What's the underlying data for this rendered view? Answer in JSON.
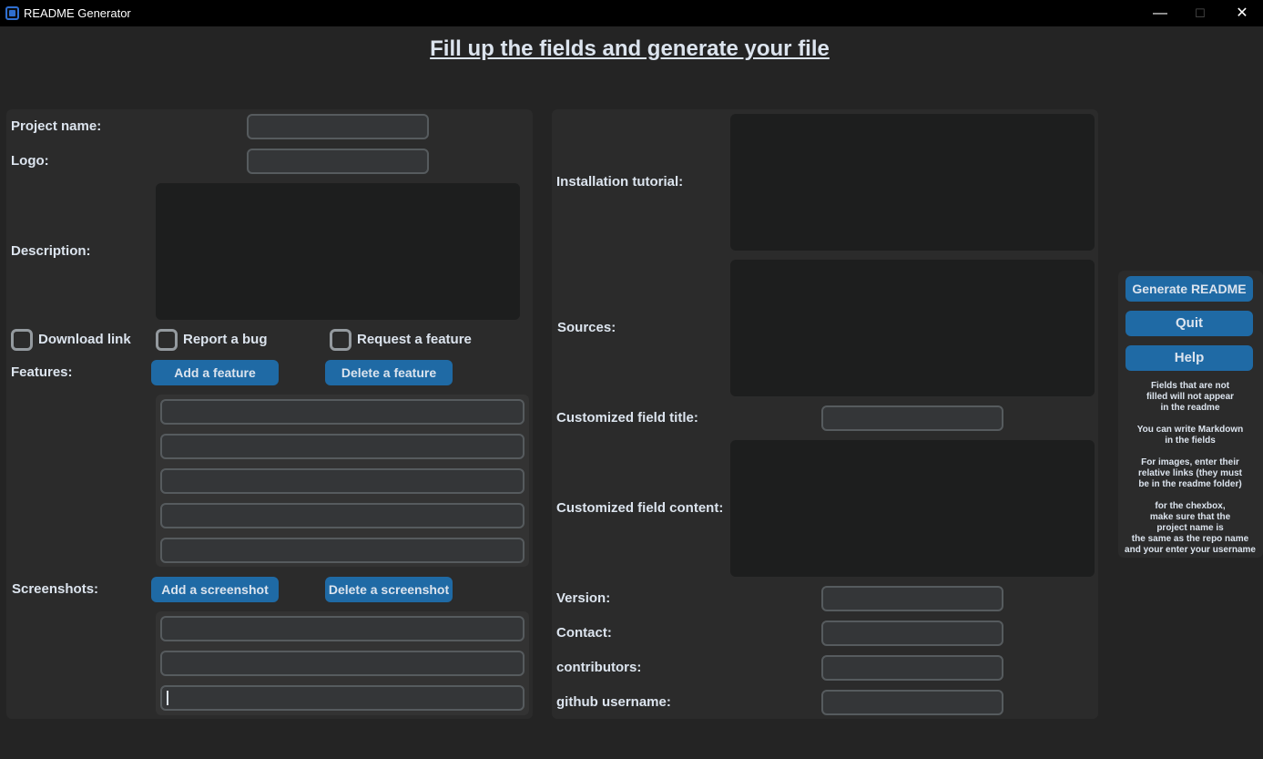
{
  "window": {
    "title": "README Generator",
    "minimize_label": "—",
    "maximize_label": "☐",
    "close_label": "✕"
  },
  "heading": "Fill up the fields and generate your file",
  "left": {
    "project_name_label": "Project name:",
    "logo_label": "Logo:",
    "description_label": "Description:",
    "download_link_label": "Download link",
    "report_bug_label": "Report a bug",
    "request_feature_label": "Request a feature",
    "features_label": "Features:",
    "add_feature_button": "Add a feature",
    "delete_feature_button": "Delete a feature",
    "screenshots_label": "Screenshots:",
    "add_screenshot_button": "Add a screenshot",
    "delete_screenshot_button": "Delete a screenshot"
  },
  "right": {
    "installation_label": "Installation tutorial:",
    "sources_label": "Sources:",
    "custom_title_label": "Customized field title:",
    "custom_content_label": "Customized field content:",
    "version_label": "Version:",
    "contact_label": "Contact:",
    "contributors_label": "contributors:",
    "github_label": "github username:"
  },
  "actions": {
    "generate_button": "Generate README",
    "quit_button": "Quit",
    "help_button": "Help",
    "help_text": "Fields that are not\nfilled will not appear\nin the readme\n\nYou can write Markdown\nin the fields\n\nFor images, enter their\nrelative links (they must\nbe in the readme folder)\n\nfor the chexbox,\nmake sure that the\nproject name is\nthe same as the repo name\nand your enter your username"
  },
  "colors": {
    "window_bg": "#242424",
    "panel_bg": "#2b2b2b",
    "button_accent": "#1f6aa5",
    "entry_bg": "#343638",
    "entry_border": "#565b5e",
    "textbox_bg": "#1d1e1e"
  }
}
